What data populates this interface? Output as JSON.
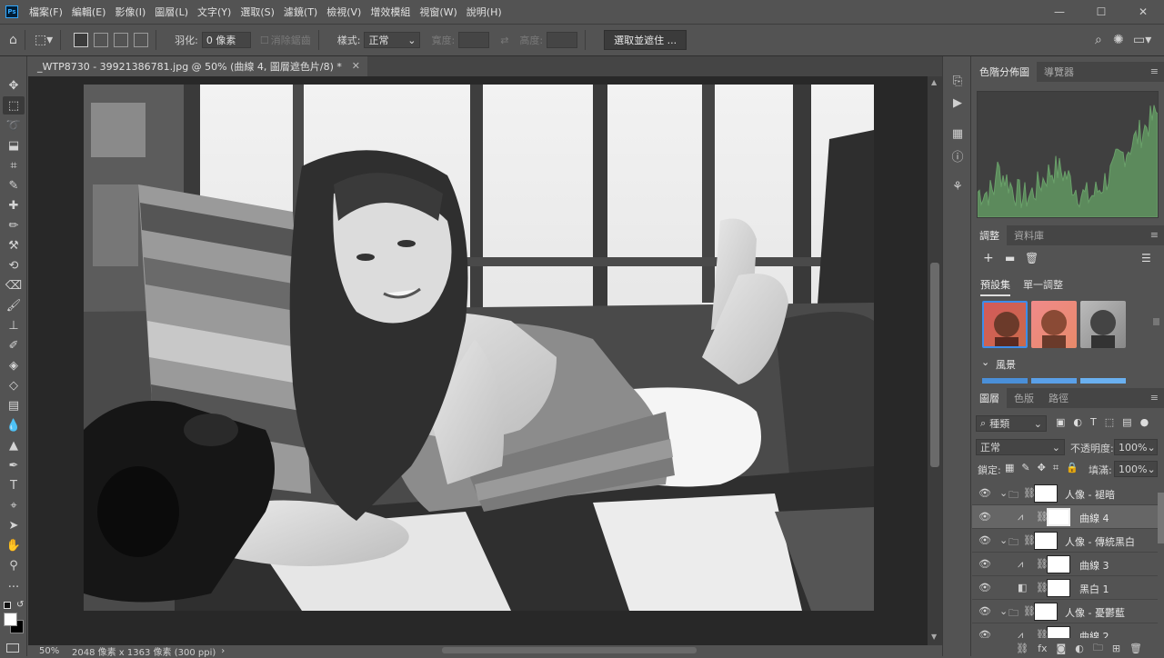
{
  "app": {
    "logo": "Ps"
  },
  "menu": [
    "檔案(F)",
    "編輯(E)",
    "影像(I)",
    "圖層(L)",
    "文字(Y)",
    "選取(S)",
    "濾鏡(T)",
    "檢視(V)",
    "增效模組",
    "視窗(W)",
    "說明(H)"
  ],
  "window_controls": {
    "minimize": "—",
    "maximize": "☐",
    "close": "✕"
  },
  "options": {
    "feather_label": "羽化:",
    "feather_value": "0 像素",
    "antialias_label": "消除鋸齒",
    "style_label": "樣式:",
    "style_value": "正常",
    "width_label": "寬度:",
    "height_label": "高度:",
    "select_mask_button": "選取並遮住 ..."
  },
  "document": {
    "tab_title": "_WTP8730 - 39921386781.jpg @ 50% (曲線 4, 圖層遮色片/8) *",
    "zoom": "50%",
    "info": "2048 像素 x 1363 像素 (300 ppi)"
  },
  "histogram_panel": {
    "tabs": [
      "色階分佈圖",
      "導覽器"
    ]
  },
  "adjustments_panel": {
    "tabs": [
      "調整",
      "資料庫"
    ],
    "subtabs": [
      "預設集",
      "單一調整"
    ],
    "section": "風景"
  },
  "layers_panel": {
    "tabs": [
      "圖層",
      "色版",
      "路徑"
    ],
    "filter_kind": "種類",
    "blend_mode": "正常",
    "opacity_label": "不透明度:",
    "opacity_value": "100%",
    "lock_label": "鎖定:",
    "fill_label": "填滿:",
    "fill_value": "100%",
    "layers": [
      {
        "name": "人像 - 褪暗",
        "type": "group",
        "selected": false
      },
      {
        "name": "曲線 4",
        "type": "curves",
        "selected": true
      },
      {
        "name": "人像 - 傳統黑白",
        "type": "group",
        "selected": false
      },
      {
        "name": "曲線 3",
        "type": "curves",
        "selected": false
      },
      {
        "name": "黑白 1",
        "type": "bw",
        "selected": false
      },
      {
        "name": "人像 - 憂鬱藍",
        "type": "group",
        "selected": false
      },
      {
        "name": "曲線 2",
        "type": "curves",
        "selected": false
      }
    ]
  },
  "colors": {
    "ui_bg": "#535353",
    "panel_dark": "#454545",
    "canvas_bg": "#282828",
    "selected_row": "#666666"
  }
}
